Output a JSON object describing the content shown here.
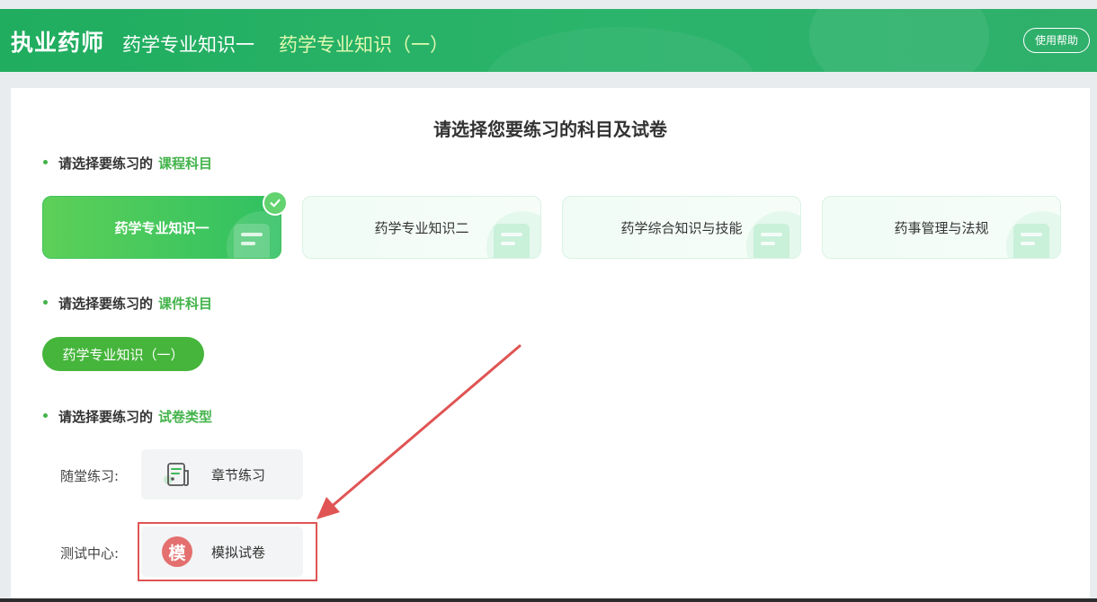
{
  "header": {
    "brand": "执业药师",
    "crumb_primary": "药学专业知识一",
    "crumb_secondary": "药学专业知识（一）",
    "help_label": "使用帮助"
  },
  "main": {
    "title": "请选择您要练习的科目及试卷",
    "section_course": {
      "prefix": "请选择要练习的",
      "highlight": "课程科目"
    },
    "section_courseware": {
      "prefix": "请选择要练习的",
      "highlight": "课件科目"
    },
    "section_paper": {
      "prefix": "请选择要练习的",
      "highlight": "试卷类型"
    },
    "subjects": [
      {
        "label": "药学专业知识一",
        "active": true
      },
      {
        "label": "药学专业知识二",
        "active": false
      },
      {
        "label": "药学综合知识与技能",
        "active": false
      },
      {
        "label": "药事管理与法规",
        "active": false
      }
    ],
    "courseware_selected": "药学专业知识（一）",
    "paper_types": [
      {
        "row_label": "随堂练习:",
        "button_label": "章节练习",
        "icon": "chapter-doc-icon"
      },
      {
        "row_label": "测试中心:",
        "button_label": "模拟试卷",
        "icon": "mock-badge-icon",
        "badge_text": "模"
      }
    ]
  },
  "colors": {
    "header_green": "#20ad5f",
    "accent_green": "#43b34a",
    "annotation_red": "#e05454",
    "mock_badge": "#e46f6f"
  }
}
